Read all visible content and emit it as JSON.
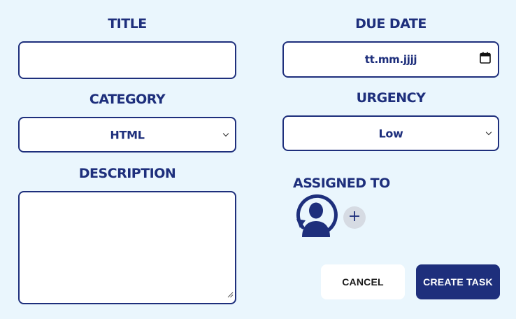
{
  "form": {
    "title": {
      "label": "TITLE",
      "value": ""
    },
    "due_date": {
      "label": "DUE DATE",
      "placeholder": "tt.mm.jjjj"
    },
    "category": {
      "label": "CATEGORY",
      "selected": "HTML"
    },
    "urgency": {
      "label": "URGENCY",
      "selected": "Low"
    },
    "description": {
      "label": "DESCRIPTION",
      "value": ""
    },
    "assigned_to": {
      "label": "ASSIGNED TO"
    }
  },
  "actions": {
    "cancel_label": "CANCEL",
    "create_label": "CREATE TASK"
  },
  "icons": {
    "due_date": "calendar-icon",
    "category": "chevron-down-icon",
    "urgency": "chevron-down-icon",
    "assignee": "user-avatar-icon",
    "add": "plus-icon"
  },
  "colors": {
    "primary": "#1e2f7c",
    "background": "#eaf6fd",
    "field_background": "#ffffff",
    "add_button": "#d6dbe3"
  }
}
